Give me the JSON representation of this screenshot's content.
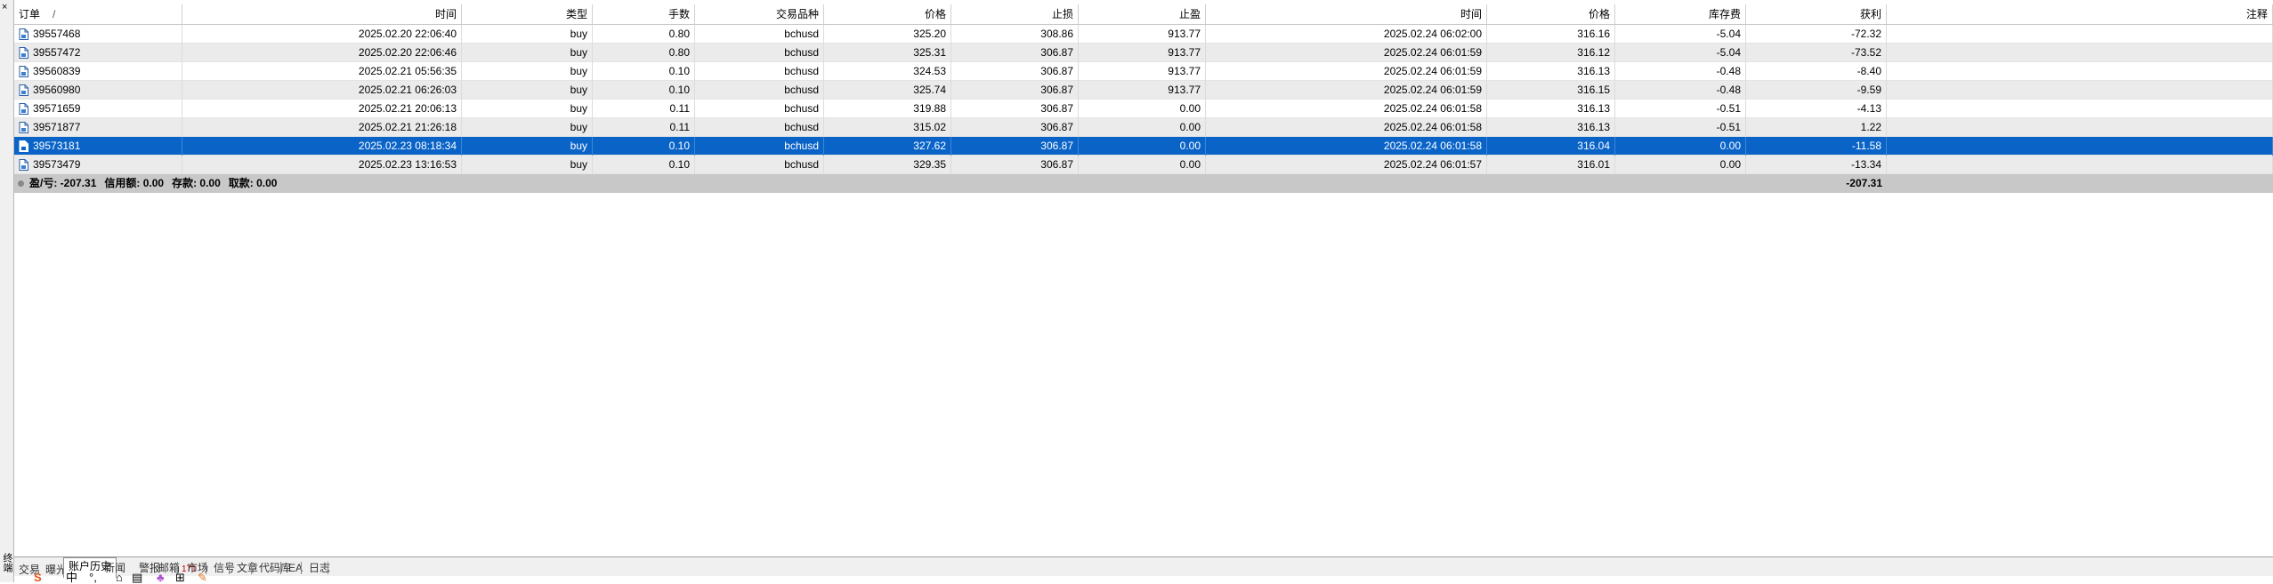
{
  "side_panel": {
    "close_glyph": "×",
    "label": "终端"
  },
  "table": {
    "columns": [
      {
        "label": "订单",
        "sort": "/"
      },
      {
        "label": "时间"
      },
      {
        "label": "类型"
      },
      {
        "label": "手数"
      },
      {
        "label": "交易品种"
      },
      {
        "label": "价格"
      },
      {
        "label": "止损"
      },
      {
        "label": "止盈"
      },
      {
        "label": "时间"
      },
      {
        "label": "价格"
      },
      {
        "label": "库存费"
      },
      {
        "label": "获利"
      },
      {
        "label": "注释"
      }
    ],
    "rows": [
      {
        "order": "39557468",
        "open_time": "2025.02.20 22:06:40",
        "type": "buy",
        "lots": "0.80",
        "symbol": "bchusd",
        "open_price": "325.20",
        "sl": "308.86",
        "tp": "913.77",
        "close_time": "2025.02.24 06:02:00",
        "close_price": "316.16",
        "swap": "-5.04",
        "profit": "-72.32",
        "comment": ""
      },
      {
        "order": "39557472",
        "open_time": "2025.02.20 22:06:46",
        "type": "buy",
        "lots": "0.80",
        "symbol": "bchusd",
        "open_price": "325.31",
        "sl": "306.87",
        "tp": "913.77",
        "close_time": "2025.02.24 06:01:59",
        "close_price": "316.12",
        "swap": "-5.04",
        "profit": "-73.52",
        "comment": ""
      },
      {
        "order": "39560839",
        "open_time": "2025.02.21 05:56:35",
        "type": "buy",
        "lots": "0.10",
        "symbol": "bchusd",
        "open_price": "324.53",
        "sl": "306.87",
        "tp": "913.77",
        "close_time": "2025.02.24 06:01:59",
        "close_price": "316.13",
        "swap": "-0.48",
        "profit": "-8.40",
        "comment": ""
      },
      {
        "order": "39560980",
        "open_time": "2025.02.21 06:26:03",
        "type": "buy",
        "lots": "0.10",
        "symbol": "bchusd",
        "open_price": "325.74",
        "sl": "306.87",
        "tp": "913.77",
        "close_time": "2025.02.24 06:01:59",
        "close_price": "316.15",
        "swap": "-0.48",
        "profit": "-9.59",
        "comment": ""
      },
      {
        "order": "39571659",
        "open_time": "2025.02.21 20:06:13",
        "type": "buy",
        "lots": "0.11",
        "symbol": "bchusd",
        "open_price": "319.88",
        "sl": "306.87",
        "tp": "0.00",
        "close_time": "2025.02.24 06:01:58",
        "close_price": "316.13",
        "swap": "-0.51",
        "profit": "-4.13",
        "comment": ""
      },
      {
        "order": "39571877",
        "open_time": "2025.02.21 21:26:18",
        "type": "buy",
        "lots": "0.11",
        "symbol": "bchusd",
        "open_price": "315.02",
        "sl": "306.87",
        "tp": "0.00",
        "close_time": "2025.02.24 06:01:58",
        "close_price": "316.13",
        "swap": "-0.51",
        "profit": "1.22",
        "comment": ""
      },
      {
        "order": "39573181",
        "open_time": "2025.02.23 08:18:34",
        "type": "buy",
        "lots": "0.10",
        "symbol": "bchusd",
        "open_price": "327.62",
        "sl": "306.87",
        "tp": "0.00",
        "close_time": "2025.02.24 06:01:58",
        "close_price": "316.04",
        "swap": "0.00",
        "profit": "-11.58",
        "comment": ""
      },
      {
        "order": "39573479",
        "open_time": "2025.02.23 13:16:53",
        "type": "buy",
        "lots": "0.10",
        "symbol": "bchusd",
        "open_price": "329.35",
        "sl": "306.87",
        "tp": "0.00",
        "close_time": "2025.02.24 06:01:57",
        "close_price": "316.01",
        "swap": "0.00",
        "profit": "-13.34",
        "comment": ""
      }
    ],
    "selected_row": 6,
    "summary": {
      "pl": "盈/亏: -207.31",
      "credit": "信用额: 0.00",
      "deposit": "存款: 0.00",
      "withdrawal": "取款: 0.00",
      "total_profit": "-207.31"
    }
  },
  "tabs": [
    {
      "label": "交易",
      "partial": true
    },
    {
      "label": "曝光",
      "partial": true
    },
    {
      "label": "账户历史",
      "active": true
    },
    {
      "label": "新闻"
    },
    {
      "label": "警报"
    },
    {
      "label": "邮箱",
      "badge": "171"
    },
    {
      "label": "市场"
    },
    {
      "label": "信号"
    },
    {
      "label": "文章"
    },
    {
      "label": "代码库"
    },
    {
      "label": "EA"
    },
    {
      "label": "日志"
    }
  ],
  "taskbar_icons": [
    {
      "name": "sogou-s-icon",
      "glyph": "S"
    },
    {
      "name": "chinese-input-icon",
      "glyph": "中"
    },
    {
      "name": "punctuation-icon",
      "glyph": "°,"
    },
    {
      "name": "microphone-icon",
      "glyph": "⌂"
    },
    {
      "name": "keyboard-icon",
      "glyph": "▤"
    },
    {
      "name": "skin-icon",
      "glyph": "♣"
    },
    {
      "name": "toolbox-icon",
      "glyph": "⊞"
    },
    {
      "name": "sogou-extra-icon",
      "glyph": "✎"
    }
  ],
  "colors": {
    "selected_row": "#0a64c8",
    "even_row": "#ebebeb",
    "summary_row": "#c8c8c8",
    "badge": "#c00000"
  }
}
